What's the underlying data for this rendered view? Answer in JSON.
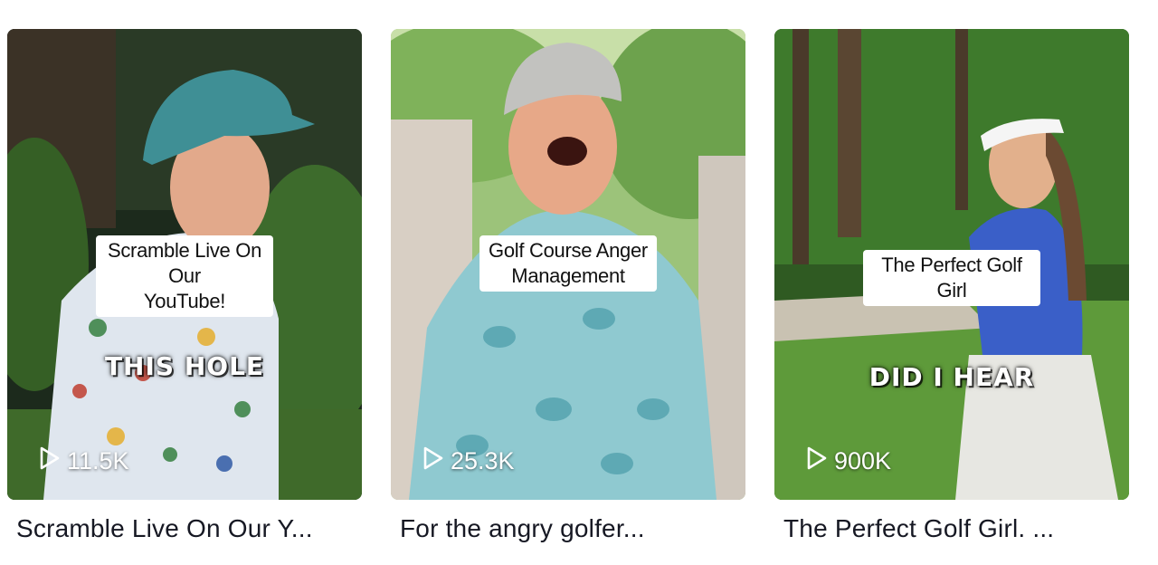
{
  "videos": [
    {
      "caption": "Scramble Live On Our\nYouTube!",
      "overlay": "THIS HOLE",
      "views": "11.5K",
      "title": "Scramble Live On Our Y...",
      "icon": "play-outline-icon"
    },
    {
      "caption": "Golf Course Anger\nManagement",
      "overlay": "",
      "views": "25.3K",
      "title": "For the angry golfer...",
      "icon": "play-outline-icon"
    },
    {
      "caption": "The Perfect Golf Girl",
      "overlay": "DID I HEAR",
      "views": "900K",
      "title": "The Perfect Golf Girl. ...",
      "icon": "play-outline-icon"
    }
  ]
}
